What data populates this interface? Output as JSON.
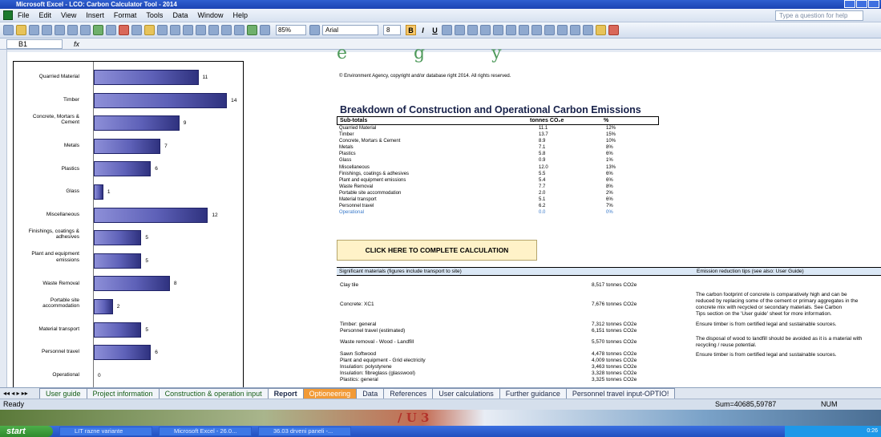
{
  "window": {
    "title": "Microsoft Excel - LCO: Carbon Calculator Tool - 2014"
  },
  "menu": [
    "File",
    "Edit",
    "View",
    "Insert",
    "Format",
    "Tools",
    "Data",
    "Window",
    "Help"
  ],
  "help_placeholder": "Type a question for help",
  "toolbar": {
    "zoom": "85%",
    "font": "Arial",
    "size": "8",
    "bold": "B",
    "italic": "I",
    "underline": "U"
  },
  "formula": {
    "cell": "B1",
    "fx": "fx"
  },
  "chart_data": {
    "type": "bar",
    "categories": [
      "Quarried Material",
      "Timber",
      "Concrete, Mortars & Cement",
      "Metals",
      "Plastics",
      "Glass",
      "Miscellaneous",
      "Finishings, coatings & adhesives",
      "Plant and equipment emissions",
      "Waste Removal",
      "Portable site accommodation",
      "Material transport",
      "Personnel travel",
      "Operational"
    ],
    "values": [
      11,
      14,
      9,
      7,
      6,
      1,
      12,
      5,
      5,
      8,
      2,
      5,
      6,
      0
    ],
    "labels": [
      "11",
      "14",
      "9",
      "7",
      "6",
      "1",
      "12",
      "5",
      "5",
      "8",
      "2",
      "5",
      "6",
      "0"
    ]
  },
  "report": {
    "copyright": "© Environment Agency, copyright and/or database right 2014. All rights reserved.",
    "title": "Breakdown of Construction and Operational Carbon Emissions",
    "col1": "Sub-totals",
    "col2": "tonnes CO₂e",
    "col3": "%",
    "rows": [
      {
        "name": "Quarried Material",
        "t": "11.1",
        "p": "12%"
      },
      {
        "name": "Timber",
        "t": "13.7",
        "p": "15%"
      },
      {
        "name": "Concrete, Mortars & Cement",
        "t": "8.9",
        "p": "10%"
      },
      {
        "name": "Metals",
        "t": "7.1",
        "p": "8%"
      },
      {
        "name": "Plastics",
        "t": "5.8",
        "p": "6%"
      },
      {
        "name": "Glass",
        "t": "0.9",
        "p": "1%"
      },
      {
        "name": "Miscellaneous",
        "t": "12.0",
        "p": "13%"
      },
      {
        "name": "Finishings, coatings & adhesives",
        "t": "5.5",
        "p": "6%"
      },
      {
        "name": "Plant and equipment emissions",
        "t": "5.4",
        "p": "6%"
      },
      {
        "name": "Waste Removal",
        "t": "7.7",
        "p": "8%"
      },
      {
        "name": "Portable site accommodation",
        "t": "2.0",
        "p": "2%"
      },
      {
        "name": "Material transport",
        "t": "5.1",
        "p": "6%"
      },
      {
        "name": "Personnel travel",
        "t": "6.2",
        "p": "7%"
      },
      {
        "name": "Operational",
        "t": "0.0",
        "p": "0%"
      }
    ],
    "calc_button": "CLICK HERE TO COMPLETE CALCULATION",
    "sig_header": "Significant materials (figures include transport to site)",
    "tips_header": "Emission reduction tips (see also: User Guide)",
    "materials": [
      {
        "name": "Clay tile",
        "val": "8,517 tonnes CO2e"
      },
      {
        "name": "Concrete: XC1",
        "val": "7,676 tonnes CO2e"
      },
      {
        "name": "Timber: general",
        "val": "7,312 tonnes CO2e"
      },
      {
        "name": "Personnel travel (estimated)",
        "val": "6,151 tonnes CO2e"
      },
      {
        "name": "Waste removal - Wood - Landfill",
        "val": "5,570 tonnes CO2e"
      },
      {
        "name": "Sawn Softwood",
        "val": "4,478 tonnes CO2e"
      },
      {
        "name": "Plant and equipment - Grid electricity",
        "val": "4,009 tonnes CO2e"
      },
      {
        "name": "Insulation: polystyrene",
        "val": "3,463 tonnes CO2e"
      },
      {
        "name": "Insulation: fibreglass (glasswool)",
        "val": "3,328 tonnes CO2e"
      },
      {
        "name": "Plastics: general",
        "val": "3,325 tonnes CO2e"
      }
    ],
    "tips": [
      "The carbon footprint of concrete is comparatively high and can be",
      "reduced by replacing some of the cement or primary aggregates in the",
      "concrete mix with recycled or secondary materials.  See Carbon",
      "Tips section on the 'User guide' sheet for more information.",
      "Ensure timber is from certified legal and sustainable sources.",
      "The disposal of wood to landfill should be avoided as it is a material with",
      "recycling / reuse potential.",
      "Ensure timber is from certified legal and sustainable sources."
    ]
  },
  "tabs": [
    "User guide",
    "Project information",
    "Construction & operation input",
    "Report",
    "Optioneering",
    "Data",
    "References",
    "User calculations",
    "Further guidance",
    "Personnel travel input-OPTIO!"
  ],
  "status": {
    "ready": "Ready",
    "sum": "Sum=40685,59787",
    "num": "NUM"
  },
  "taskbar": {
    "start": "start",
    "items": [
      "LIT razne variante",
      "Microsoft Excel - 26.0...",
      "36.03 drveni paneli -..."
    ],
    "tray": "0:26"
  },
  "wallpaper_text": "/ U 3"
}
